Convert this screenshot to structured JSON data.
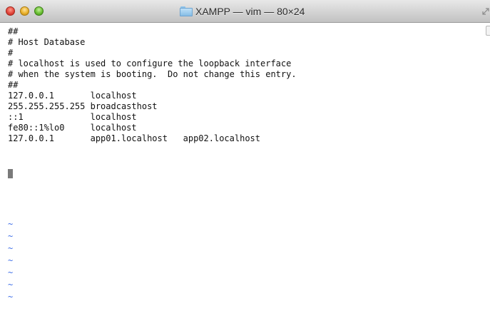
{
  "window": {
    "title": "XAMPP — vim — 80×24",
    "title_icon": "folder-icon"
  },
  "colors": {
    "titlebar": "#d3d3d3",
    "text": "#111111",
    "tilde": "#3f6fe8",
    "cursor": "#7a7a7a"
  },
  "editor": {
    "lines": [
      "##",
      "# Host Database",
      "#",
      "# localhost is used to configure the loopback interface",
      "# when the system is booting.  Do not change this entry.",
      "##",
      "127.0.0.1       localhost",
      "255.255.255.255 broadcasthost",
      "::1             localhost",
      "fe80::1%lo0     localhost",
      "127.0.0.1       app01.localhost   app02.localhost"
    ],
    "tildes": [
      "~",
      "~",
      "~",
      "~",
      "~",
      "~",
      "~"
    ]
  }
}
